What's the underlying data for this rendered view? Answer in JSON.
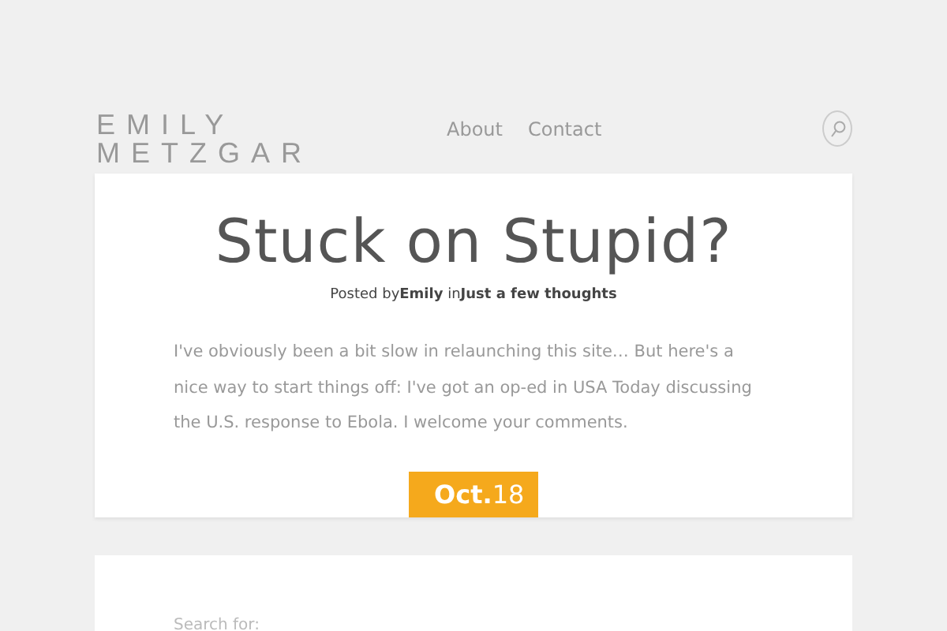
{
  "site_title": [
    "EMILY",
    "METZGAR"
  ],
  "nav": [
    "About",
    "Contact"
  ],
  "post": {
    "title": "Stuck on Stupid?",
    "byline": "Posted by**Emily** in**Just a few thoughts**",
    "body": "I've obviously been a bit slow in relaunching this site… But here's a nice way to start things off: I've got an op-ed in USA Today discussing the U.S. response to Ebola. I welcome your comments.",
    "date": "**Oct.**18"
  },
  "search": {
    "label": "Search for:"
  }
}
